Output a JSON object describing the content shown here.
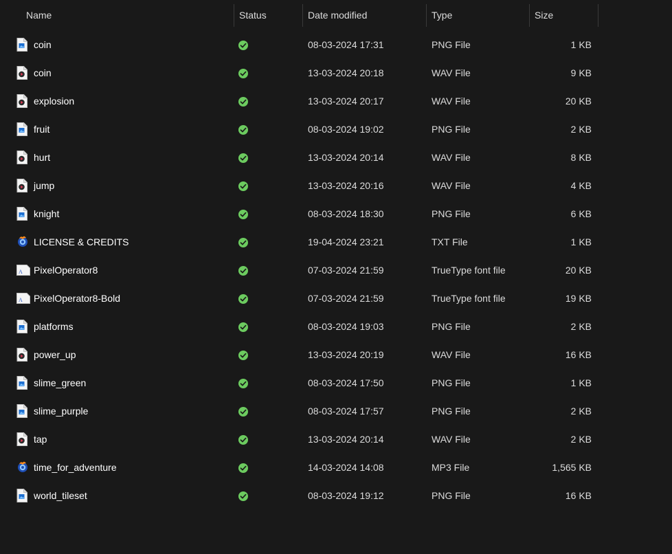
{
  "columns": {
    "name": "Name",
    "status": "Status",
    "date_modified": "Date modified",
    "type": "Type",
    "size": "Size"
  },
  "sort_indicator": "chevron-up-icon",
  "status_icon": "synced-check-icon",
  "colors": {
    "background": "#191919",
    "status_green": "#6ccb5f",
    "separator": "#3a3a3a"
  },
  "files": [
    {
      "name": "coin",
      "icon": "png-image-icon",
      "date": "08-03-2024 17:31",
      "type": "PNG File",
      "size": "1 KB"
    },
    {
      "name": "coin",
      "icon": "wav-audio-icon",
      "date": "13-03-2024 20:18",
      "type": "WAV File",
      "size": "9 KB"
    },
    {
      "name": "explosion",
      "icon": "wav-audio-icon",
      "date": "13-03-2024 20:17",
      "type": "WAV File",
      "size": "20 KB"
    },
    {
      "name": "fruit",
      "icon": "png-image-icon",
      "date": "08-03-2024 19:02",
      "type": "PNG File",
      "size": "2 KB"
    },
    {
      "name": "hurt",
      "icon": "wav-audio-icon",
      "date": "13-03-2024 20:14",
      "type": "WAV File",
      "size": "8 KB"
    },
    {
      "name": "jump",
      "icon": "wav-audio-icon",
      "date": "13-03-2024 20:16",
      "type": "WAV File",
      "size": "4 KB"
    },
    {
      "name": "knight",
      "icon": "png-image-icon",
      "date": "08-03-2024 18:30",
      "type": "PNG File",
      "size": "6 KB"
    },
    {
      "name": "LICENSE & CREDITS",
      "icon": "txt-app-icon",
      "date": "19-04-2024 23:21",
      "type": "TXT File",
      "size": "1 KB"
    },
    {
      "name": "PixelOperator8",
      "icon": "font-file-icon",
      "date": "07-03-2024 21:59",
      "type": "TrueType font file",
      "size": "20 KB"
    },
    {
      "name": "PixelOperator8-Bold",
      "icon": "font-file-icon",
      "date": "07-03-2024 21:59",
      "type": "TrueType font file",
      "size": "19 KB"
    },
    {
      "name": "platforms",
      "icon": "png-image-icon",
      "date": "08-03-2024 19:03",
      "type": "PNG File",
      "size": "2 KB"
    },
    {
      "name": "power_up",
      "icon": "wav-audio-icon",
      "date": "13-03-2024 20:19",
      "type": "WAV File",
      "size": "16 KB"
    },
    {
      "name": "slime_green",
      "icon": "png-image-icon",
      "date": "08-03-2024 17:50",
      "type": "PNG File",
      "size": "1 KB"
    },
    {
      "name": "slime_purple",
      "icon": "png-image-icon",
      "date": "08-03-2024 17:57",
      "type": "PNG File",
      "size": "2 KB"
    },
    {
      "name": "tap",
      "icon": "wav-audio-icon",
      "date": "13-03-2024 20:14",
      "type": "WAV File",
      "size": "2 KB"
    },
    {
      "name": "time_for_adventure",
      "icon": "mp3-app-icon",
      "date": "14-03-2024 14:08",
      "type": "MP3 File",
      "size": "1,565 KB"
    },
    {
      "name": "world_tileset",
      "icon": "png-image-icon",
      "date": "08-03-2024 19:12",
      "type": "PNG File",
      "size": "16 KB"
    }
  ]
}
